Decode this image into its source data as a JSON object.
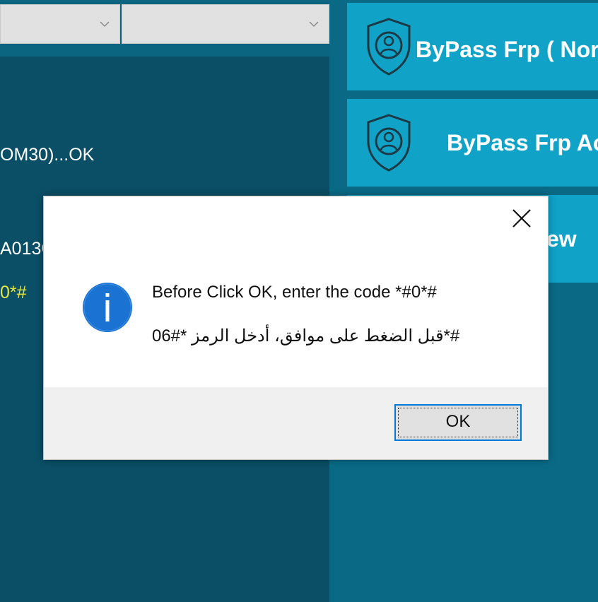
{
  "background": {
    "log_lines": [
      "OM30)...OK",
      "A013G",
      "0*#"
    ],
    "tiles": [
      {
        "label": "ByPass Frp ( Nor",
        "icon": "shield-user-icon"
      },
      {
        "label": "ByPass Frp Ac",
        "icon": "shield-user-icon"
      },
      {
        "label": "ew",
        "icon": ""
      }
    ]
  },
  "dialog": {
    "message_en": "Before Click OK, enter the code *#0*#",
    "message_ar": "#*قبل الضغط على موافق، أدخل الرمز *#06",
    "ok_label": "OK",
    "icon": "info-icon",
    "close_icon": "close-icon"
  },
  "colors": {
    "app_bg": "#0a4f66",
    "tile_bg": "#10a2c7",
    "info_blue": "#1a73d2",
    "button_focus": "#0078d7"
  }
}
